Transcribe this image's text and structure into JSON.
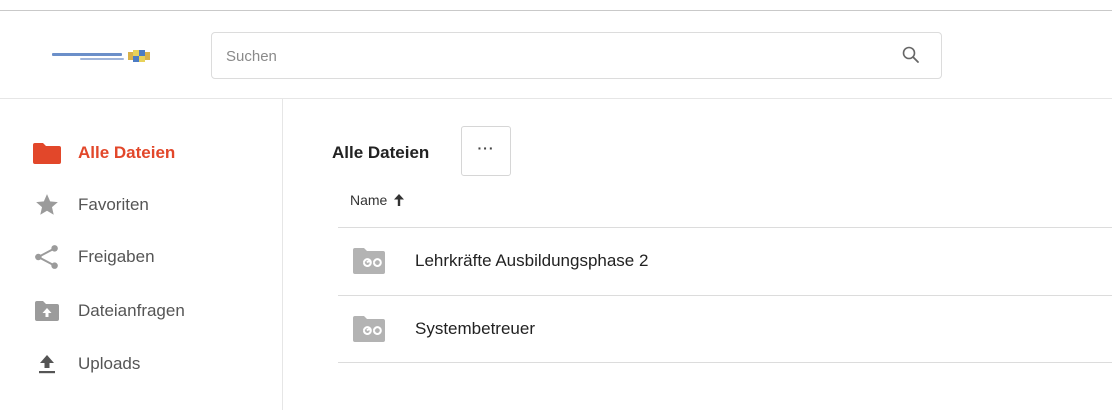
{
  "search": {
    "placeholder": "Suchen"
  },
  "sidebar": {
    "items": [
      {
        "label": "Alle Dateien",
        "icon": "folder-icon",
        "active": true
      },
      {
        "label": "Favoriten",
        "icon": "star-icon",
        "active": false
      },
      {
        "label": "Freigaben",
        "icon": "share-icon",
        "active": false
      },
      {
        "label": "Dateianfragen",
        "icon": "folder-upload-icon",
        "active": false
      },
      {
        "label": "Uploads",
        "icon": "upload-icon",
        "active": false
      }
    ]
  },
  "main": {
    "title": "Alle Dateien",
    "more_label": "···",
    "columns": {
      "name": "Name"
    },
    "rows": [
      {
        "name": "Lehrkräfte Ausbildungsphase 2",
        "icon": "shared-folder-icon"
      },
      {
        "name": "Systembetreuer",
        "icon": "shared-folder-icon"
      }
    ]
  },
  "colors": {
    "accent": "#e2472a",
    "icon_gray": "#9b9b9b",
    "border": "#dcdcdc"
  }
}
